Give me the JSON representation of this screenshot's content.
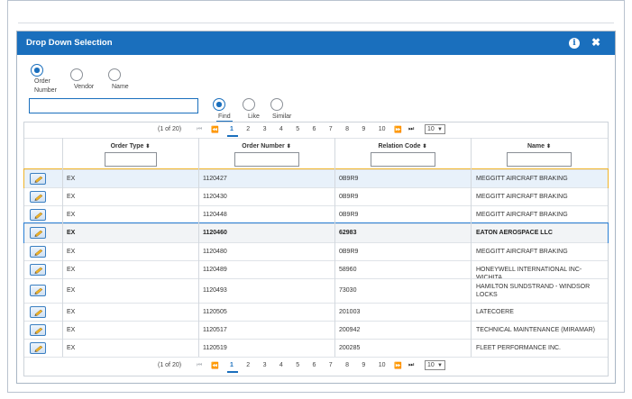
{
  "dialog": {
    "title": "Drop Down Selection",
    "close_symbol": "✖",
    "info_symbol": "i"
  },
  "search_by": [
    {
      "label_lines": [
        "Order",
        "Number"
      ],
      "selected": true
    },
    {
      "label_lines": [
        "Vendor"
      ],
      "selected": false
    },
    {
      "label_lines": [
        "Name"
      ],
      "selected": false
    }
  ],
  "search": {
    "value": ""
  },
  "match_mode": [
    {
      "label": "Find",
      "selected": true
    },
    {
      "label": "Like",
      "selected": false
    },
    {
      "label": "Similar",
      "selected": false
    }
  ],
  "pager": {
    "info": "(1 of 20)",
    "pages": [
      "1",
      "2",
      "3",
      "4",
      "5",
      "6",
      "7",
      "8",
      "9",
      "10"
    ],
    "current_page": "1",
    "page_size": "10",
    "first": "⏮",
    "prev": "⏪",
    "next": "⏩",
    "last": "⏭"
  },
  "columns": [
    {
      "label": "Order Type"
    },
    {
      "label": "Order Number"
    },
    {
      "label": "Relation Code"
    },
    {
      "label": "Name"
    }
  ],
  "rows": [
    {
      "type": "EX",
      "number": "1120427",
      "code": "0B9R9",
      "name": [
        "MEGGITT AIRCRAFT BRAKING"
      ],
      "state": "hover"
    },
    {
      "type": "EX",
      "number": "1120430",
      "code": "0B9R9",
      "name": [
        "MEGGITT AIRCRAFT BRAKING"
      ],
      "state": ""
    },
    {
      "type": "EX",
      "number": "1120448",
      "code": "0B9R9",
      "name": [
        "MEGGITT AIRCRAFT BRAKING"
      ],
      "state": ""
    },
    {
      "type": "EX",
      "number": "1120460",
      "code": "62983",
      "name": [
        "EATON AEROSPACE LLC"
      ],
      "state": "selected"
    },
    {
      "type": "EX",
      "number": "1120480",
      "code": "0B9R9",
      "name": [
        "MEGGITT AIRCRAFT BRAKING"
      ],
      "state": ""
    },
    {
      "type": "EX",
      "number": "1120489",
      "code": "58960",
      "name": [
        "HONEYWELL INTERNATIONAL INC-WICHITA"
      ],
      "state": ""
    },
    {
      "type": "EX",
      "number": "1120493",
      "code": "73030",
      "name": [
        "HAMILTON SUNDSTRAND - WINDSOR",
        "LOCKS"
      ],
      "state": ""
    },
    {
      "type": "EX",
      "number": "1120505",
      "code": "201003",
      "name": [
        "LATECOERE"
      ],
      "state": ""
    },
    {
      "type": "EX",
      "number": "1120517",
      "code": "200942",
      "name": [
        "TECHNICAL MAINTENANCE (MIRAMAR)"
      ],
      "state": ""
    },
    {
      "type": "EX",
      "number": "1120519",
      "code": "200285",
      "name": [
        "FLEET PERFORMANCE INC."
      ],
      "state": ""
    }
  ],
  "colors": {
    "accent": "#1a6fbd",
    "hover_outline": "#f0b429",
    "selected_outline": "#2a7fd4"
  }
}
